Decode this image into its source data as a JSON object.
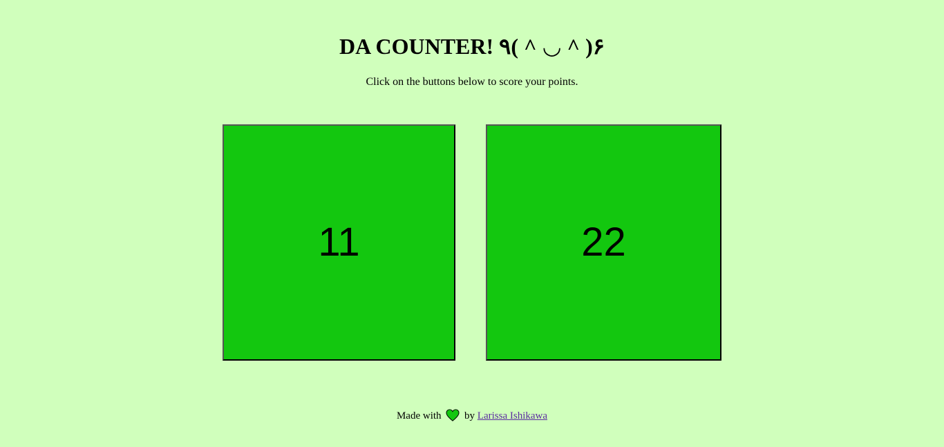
{
  "header": {
    "title": "DA COUNTER! ٩( ^ ◡ ^ )۶",
    "subtitle": "Click on the buttons below to score your points."
  },
  "counters": [
    {
      "value": "11"
    },
    {
      "value": "22"
    }
  ],
  "footer": {
    "made_with": "Made with",
    "heart_icon": "heart-icon",
    "by": "by",
    "author": "Larissa Ishikawa"
  },
  "colors": {
    "background": "#d0ffbc",
    "button": "#13c70f",
    "heart": "#13c70f",
    "link": "#5b2ca0"
  }
}
